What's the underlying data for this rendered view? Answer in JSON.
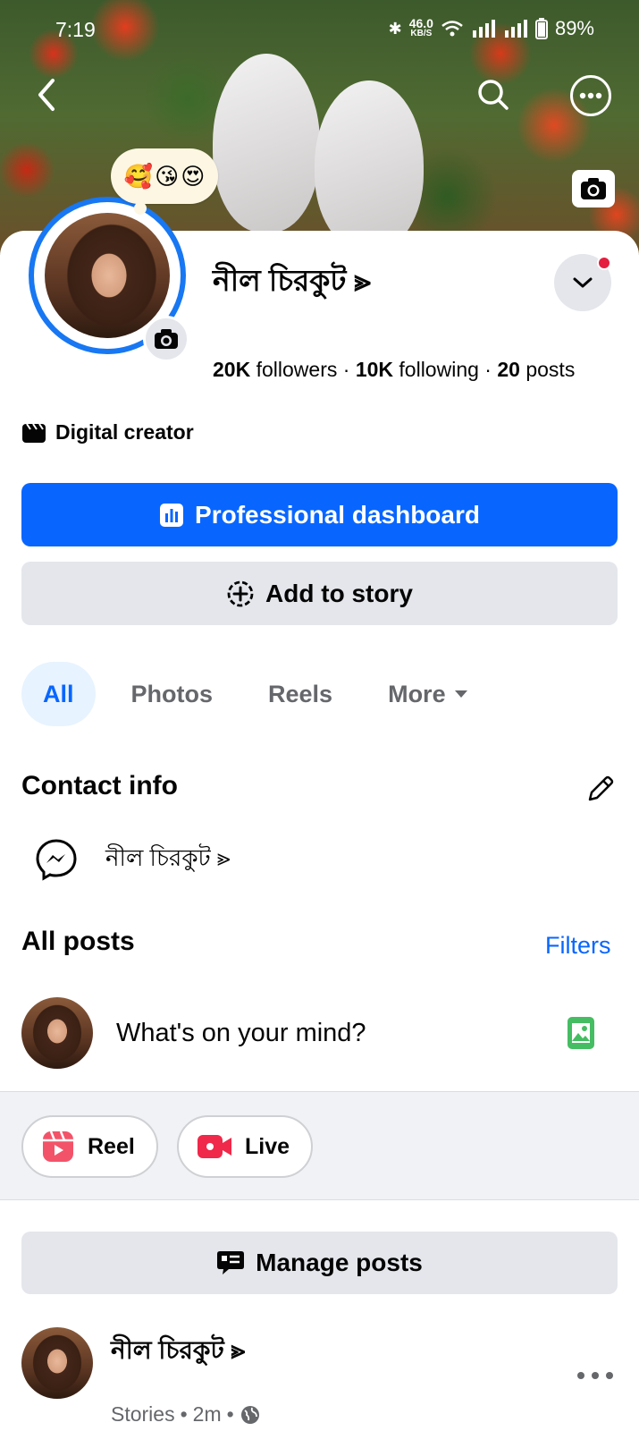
{
  "status_bar": {
    "time": "7:19",
    "net_speed": "46.0",
    "net_unit": "KB/S",
    "battery": "89%"
  },
  "cover": {
    "reactions": [
      "🥰",
      "😘",
      "😍"
    ]
  },
  "profile": {
    "name": "নীল চিরকুট ⪢",
    "followers_count": "20K",
    "followers_label": "followers",
    "following_count": "10K",
    "following_label": "following",
    "posts_count": "20",
    "posts_label": "posts",
    "separator": "·",
    "category": "Digital creator"
  },
  "actions": {
    "dashboard_label": "Professional dashboard",
    "story_label": "Add to story"
  },
  "tabs": [
    {
      "label": "All",
      "active": true
    },
    {
      "label": "Photos",
      "active": false
    },
    {
      "label": "Reels",
      "active": false
    },
    {
      "label": "More",
      "active": false
    }
  ],
  "contact": {
    "title": "Contact info",
    "messenger_name": "নীল চিরকুট ⪢"
  },
  "posts": {
    "title": "All posts",
    "filters_label": "Filters",
    "composer_placeholder": "What's on your mind?",
    "reel_label": "Reel",
    "live_label": "Live",
    "manage_label": "Manage posts"
  },
  "post": {
    "author": "নীল চিরকুট ⪢",
    "source": "Stories",
    "time": "2m",
    "meta_sep": "•"
  },
  "colors": {
    "accent": "#0866ff",
    "ring": "#1877f2",
    "notification": "#e41e3f",
    "live_red": "#f02849",
    "photo_green": "#45bd62"
  }
}
